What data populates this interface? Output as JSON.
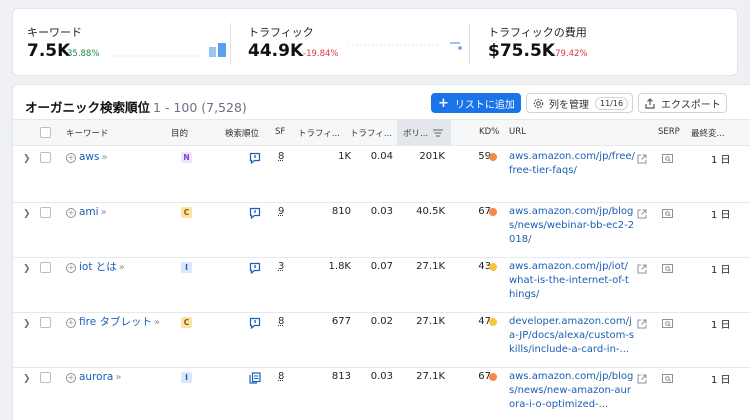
{
  "metrics": [
    {
      "label": "キーワード",
      "value": "7.5K",
      "change": "35.88%",
      "direction": "up"
    },
    {
      "label": "トラフィック",
      "value": "44.9K",
      "change": "-19.84%",
      "direction": "down"
    },
    {
      "label": "トラフィックの費用",
      "value": "$75.5K",
      "change": "-79.42%",
      "direction": "down"
    }
  ],
  "panel": {
    "title": "オーガニック検索順位",
    "range": "1 - 100 (7,528)",
    "add_to_list": "リストに追加",
    "manage_columns": "列を管理",
    "columns_count": "11/16",
    "export": "エクスポート"
  },
  "columns": {
    "keyword": "キーワード",
    "intent": "目的",
    "position": "検索順位",
    "sf": "SF",
    "traffic": "トラフィ...",
    "traffic_pct": "トラフィ...",
    "volume": "ボリ...",
    "kd": "KD%",
    "url": "URL",
    "serp": "SERP",
    "updated": "最終変..."
  },
  "colors": {
    "accent": "#1a73e8",
    "link": "#1a5fb4",
    "kd_orange": "#f08a4b",
    "kd_yellow": "#f5c542",
    "intent_n": "#efe4fb",
    "intent_c": "#fbe3a7",
    "intent_i": "#dbe7fb"
  },
  "rows": [
    {
      "keyword": "aws",
      "intent": "N",
      "sf": "8",
      "traffic": "1K",
      "traffic_pct": "0.04",
      "volume": "201K",
      "kd": "59",
      "kd_color": "orange",
      "url": "aws.amazon.com/jp/free/free-tier-faqs/",
      "updated": "1 日",
      "serp_icon": "featured-snippet-icon"
    },
    {
      "keyword": "ami",
      "intent": "C",
      "sf": "9",
      "traffic": "810",
      "traffic_pct": "0.03",
      "volume": "40.5K",
      "kd": "67",
      "kd_color": "orange",
      "url": "aws.amazon.com/jp/blogs/news/webinar-bb-ec2-2018/",
      "updated": "1 日",
      "serp_icon": "featured-snippet-icon"
    },
    {
      "keyword": "iot とは",
      "intent": "I",
      "sf": "3",
      "traffic": "1.8K",
      "traffic_pct": "0.07",
      "volume": "27.1K",
      "kd": "43",
      "kd_color": "yellow",
      "url": "aws.amazon.com/jp/iot/what-is-the-internet-of-things/",
      "updated": "1 日",
      "serp_icon": "featured-snippet-icon"
    },
    {
      "keyword": "fire タブレット",
      "intent": "C",
      "sf": "8",
      "traffic": "677",
      "traffic_pct": "0.02",
      "volume": "27.1K",
      "kd": "47",
      "kd_color": "yellow",
      "url": "developer.amazon.com/ja-JP/docs/alexa/custom-skills/include-a-card-in-...",
      "updated": "1 日",
      "serp_icon": "featured-snippet-icon"
    },
    {
      "keyword": "aurora",
      "intent": "I",
      "sf": "8",
      "traffic": "813",
      "traffic_pct": "0.03",
      "volume": "27.1K",
      "kd": "67",
      "kd_color": "orange",
      "url": "aws.amazon.com/jp/blogs/news/new-amazon-aurora-i-o-optimized-...",
      "updated": "1 日",
      "serp_icon": "copy-pages-icon"
    }
  ]
}
